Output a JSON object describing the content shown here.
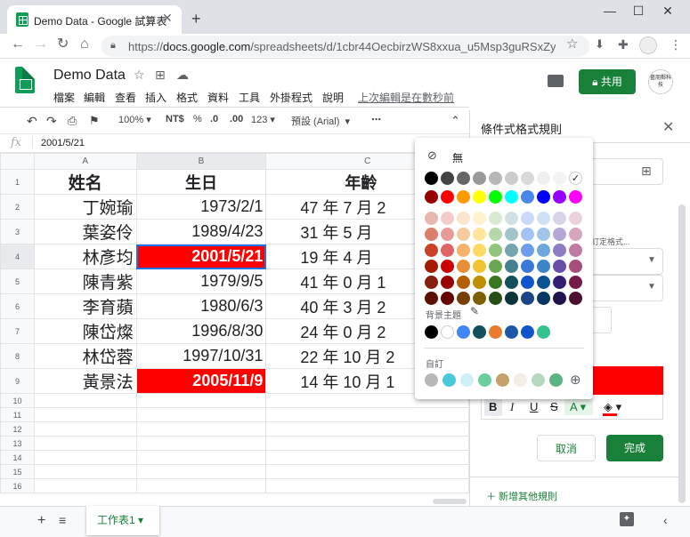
{
  "browser": {
    "tab_title": "Demo Data - Google 試算表",
    "url_prefix": "https://",
    "url_host": "docs.google.com",
    "url_path": "/spreadsheets/d/1cbr44OecbirzWS8xxua_u5Msp3guRSxZyX2..."
  },
  "doc": {
    "title": "Demo Data",
    "menus": [
      "檔案",
      "編輯",
      "查看",
      "插入",
      "格式",
      "資料",
      "工具",
      "外掛程式",
      "說明"
    ],
    "last_edit": "上次編輯是在數秒前",
    "share_label": "共用",
    "avatar_text": "藝朋鄰科技"
  },
  "toolbar": {
    "zoom": "100%",
    "currency": "NT$",
    "percent": "%",
    "dec_less": ".0",
    "dec_more": ".00",
    "format": "123",
    "font": "預設 (Arial)",
    "more": "⋯"
  },
  "formula": {
    "fx": "fx",
    "value": "2001/5/21"
  },
  "columns": [
    "A",
    "B",
    "C"
  ],
  "rows": [
    {
      "num": "1",
      "name": "姓名",
      "birth": "生日",
      "age": "年齡"
    },
    {
      "num": "2",
      "name": "丁婉瑜",
      "birth": "1973/2/1",
      "age": "47 年 7 月 2"
    },
    {
      "num": "3",
      "name": "葉姿伶",
      "birth": "1989/4/23",
      "age": "31 年 5 月"
    },
    {
      "num": "4",
      "name": "林彥均",
      "birth": "2001/5/21",
      "age": "19 年 4 月"
    },
    {
      "num": "5",
      "name": "陳青紫",
      "birth": "1979/9/5",
      "age": "41 年 0 月 1"
    },
    {
      "num": "6",
      "name": "李育蘋",
      "birth": "1980/6/3",
      "age": "40 年 3 月 2"
    },
    {
      "num": "7",
      "name": "陳岱燦",
      "birth": "1996/8/30",
      "age": "24 年 0 月 2"
    },
    {
      "num": "8",
      "name": "林岱蓉",
      "birth": "1997/10/31",
      "age": "22 年 10 月 2"
    },
    {
      "num": "9",
      "name": "黃景法",
      "birth": "2005/11/9",
      "age": "14 年 10 月 1"
    }
  ],
  "empty_rows": [
    "10",
    "11",
    "12",
    "13",
    "14",
    "15",
    "16"
  ],
  "sheet_tab": "工作表1",
  "panel": {
    "title": "條件式格式規則",
    "note": "訂定格式...",
    "cancel": "取消",
    "done": "完成",
    "add_rule": "＋ 新增其他規則"
  },
  "color_popup": {
    "none_label": "無",
    "theme_label": "背景主題",
    "custom_label": "自訂",
    "grays": [
      "#000000",
      "#434343",
      "#666666",
      "#999999",
      "#b7b7b7",
      "#cccccc",
      "#d9d9d9",
      "#efefef",
      "#f3f3f3",
      "#ffffff"
    ],
    "brights": [
      "#980000",
      "#ff0000",
      "#ff9900",
      "#ffff00",
      "#00ff00",
      "#00ffff",
      "#4a86e8",
      "#0000ff",
      "#9900ff",
      "#ff00ff"
    ],
    "shades": [
      [
        "#e6b8af",
        "#f4cccc",
        "#fce5cd",
        "#fff2cc",
        "#d9ead3",
        "#d0e0e3",
        "#c9daf8",
        "#cfe2f3",
        "#d9d2e9",
        "#ead1dc"
      ],
      [
        "#dd7e6b",
        "#ea9999",
        "#f9cb9c",
        "#ffe599",
        "#b6d7a8",
        "#a2c4c9",
        "#a4c2f4",
        "#9fc5e8",
        "#b4a7d6",
        "#d5a6bd"
      ],
      [
        "#cc4125",
        "#e06666",
        "#f6b26b",
        "#ffd966",
        "#93c47d",
        "#76a5af",
        "#6d9eeb",
        "#6fa8dc",
        "#8e7cc3",
        "#c27ba0"
      ],
      [
        "#a61c00",
        "#cc0000",
        "#e69138",
        "#f1c232",
        "#6aa84f",
        "#45818e",
        "#3c78d8",
        "#3d85c6",
        "#674ea7",
        "#a64d79"
      ],
      [
        "#85200c",
        "#990000",
        "#b45f06",
        "#bf9000",
        "#38761d",
        "#134f5c",
        "#1155cc",
        "#0b5394",
        "#351c75",
        "#741b47"
      ],
      [
        "#5b0f00",
        "#660000",
        "#783f04",
        "#7f6000",
        "#274e13",
        "#0c343d",
        "#1c4587",
        "#073763",
        "#20124d",
        "#4c1130"
      ]
    ],
    "theme": [
      "#000000",
      "#ffffff",
      "#4285f4",
      "#134f5c",
      "#ea7a2d",
      "#1d57a8",
      "#1155cc",
      "#34c38f"
    ],
    "custom": [
      "#b7b7b7",
      "#47c9d9",
      "#cfeff6",
      "#6bcf9b",
      "#c4a16b",
      "#f4ede6",
      "#b6d7c0",
      "#5bb383"
    ]
  }
}
